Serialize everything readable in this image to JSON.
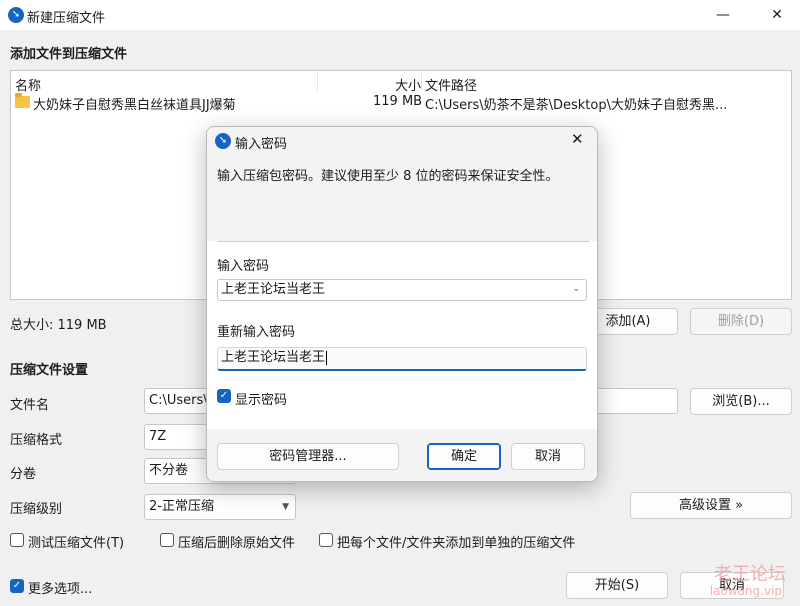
{
  "window": {
    "title": "新建压缩文件",
    "minimize_icon": "minimize-icon",
    "close_icon": "close-icon"
  },
  "add_section": {
    "heading": "添加文件到压缩文件",
    "columns": {
      "name": "名称",
      "size": "大小",
      "path": "文件路径"
    },
    "rows": [
      {
        "name": "大奶妹子自慰秀黑白丝袜道具JJ爆菊",
        "size": "119 MB",
        "path": "C:\\Users\\奶茶不是茶\\Desktop\\大奶妹子自慰秀黑..."
      }
    ],
    "total_size": "总大小: 119 MB",
    "add_button": "添加(A)",
    "delete_button": "删除(D)"
  },
  "settings": {
    "heading": "压缩文件设置",
    "filename_label": "文件名",
    "filename_value": "C:\\Users\\奶",
    "browse_button": "浏览(B)...",
    "format_label": "压缩格式",
    "format_value": "7Z",
    "volume_label": "分卷",
    "volume_value": "不分卷",
    "level_label": "压缩级别",
    "level_value": "2-正常压缩",
    "advanced_button": "高级设置 »",
    "test_checkbox": "测试压缩文件(T)",
    "delete_original_checkbox": "压缩后删除原始文件",
    "separate_checkbox": "把每个文件/文件夹添加到单独的压缩文件",
    "more_options": "更多选项...",
    "start_button": "开始(S)",
    "cancel_button": "取消"
  },
  "dialog": {
    "title": "输入密码",
    "description": "输入压缩包密码。建议使用至少 8 位的密码来保证安全性。",
    "password_label": "输入密码",
    "password_value": "上老王论坛当老王",
    "reenter_label": "重新输入密码",
    "reenter_value": "上老王论坛当老王",
    "show_password": "显示密码",
    "show_password_checked": true,
    "manager_button": "密码管理器...",
    "ok_button": "确定",
    "cancel_button": "取消"
  },
  "watermark": {
    "line1": "老王论坛",
    "line2": "laowang.vip"
  },
  "colors": {
    "accent": "#1565c0",
    "watermark": "#f1a0a0"
  }
}
